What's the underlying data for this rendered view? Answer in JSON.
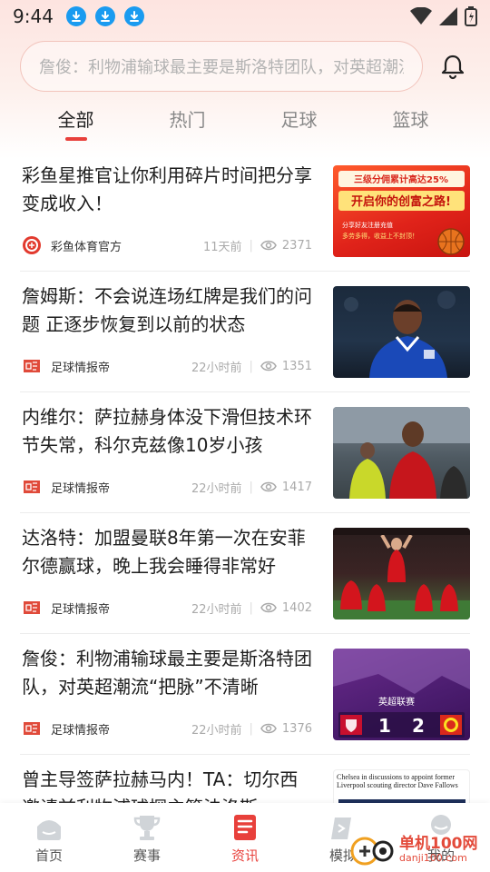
{
  "status_bar": {
    "time": "9:44",
    "icons": [
      "download-icon",
      "download-icon",
      "download-icon",
      "wifi-icon",
      "signal-icon",
      "battery-icon"
    ]
  },
  "search": {
    "placeholder": "詹俊：利物浦输球最主要是斯洛特团队，对英超潮流"
  },
  "tabs": [
    {
      "label": "全部",
      "active": true
    },
    {
      "label": "热门",
      "active": false
    },
    {
      "label": "足球",
      "active": false
    },
    {
      "label": "篮球",
      "active": false
    }
  ],
  "feed": [
    {
      "title": "彩鱼星推官让你利用碎片时间把分享变成收入！",
      "source": "彩鱼体育官方",
      "time": "11天前",
      "views": "2371",
      "thumb": {
        "line1": "三级分佣累计高达25%",
        "line2": "开启你的创富之路!",
        "line3": "分享好友注册充值",
        "line4": "多劳多得，收益上不封顶！"
      }
    },
    {
      "title": "詹姆斯：不会说连场红牌是我们的问题 正逐步恢复到以前的状态",
      "source": "足球情报帝",
      "time": "22小时前",
      "views": "1351"
    },
    {
      "title": "内维尔：萨拉赫身体没下滑但技术环节失常，科尔克兹像10岁小孩",
      "source": "足球情报帝",
      "time": "22小时前",
      "views": "1417"
    },
    {
      "title": "达洛特：加盟曼联8年第一次在安菲尔德赢球，晚上我会睡得非常好",
      "source": "足球情报帝",
      "time": "22小时前",
      "views": "1402"
    },
    {
      "title": "詹俊：利物浦输球最主要是斯洛特团队，对英超潮流“把脉”不清晰",
      "source": "足球情报帝",
      "time": "22小时前",
      "views": "1376",
      "thumb": {
        "banner": "英超联赛",
        "score_home": "1",
        "score_away": "2"
      }
    },
    {
      "title": "曾主导签萨拉赫马内！TA：切尔西邀请前利物浦球探主管法洛斯",
      "thumb": {
        "caption": "Chelsea in discussions to appoint former Liverpool scouting director Dave Fallows"
      }
    }
  ],
  "bottom_nav": [
    {
      "label": "首页",
      "icon": "home-icon",
      "active": false
    },
    {
      "label": "赛事",
      "icon": "trophy-icon",
      "active": false
    },
    {
      "label": "资讯",
      "icon": "news-icon",
      "active": true
    },
    {
      "label": "模拟",
      "icon": "simulate-icon",
      "active": false
    },
    {
      "label": "我的",
      "icon": "profile-icon",
      "active": false
    }
  ],
  "watermark": {
    "main": "单机100网",
    "sub": "danji100.com"
  },
  "colors": {
    "accent": "#e8403b",
    "download_badge": "#1a9bf0",
    "header_gradient": "#fde4e0"
  }
}
